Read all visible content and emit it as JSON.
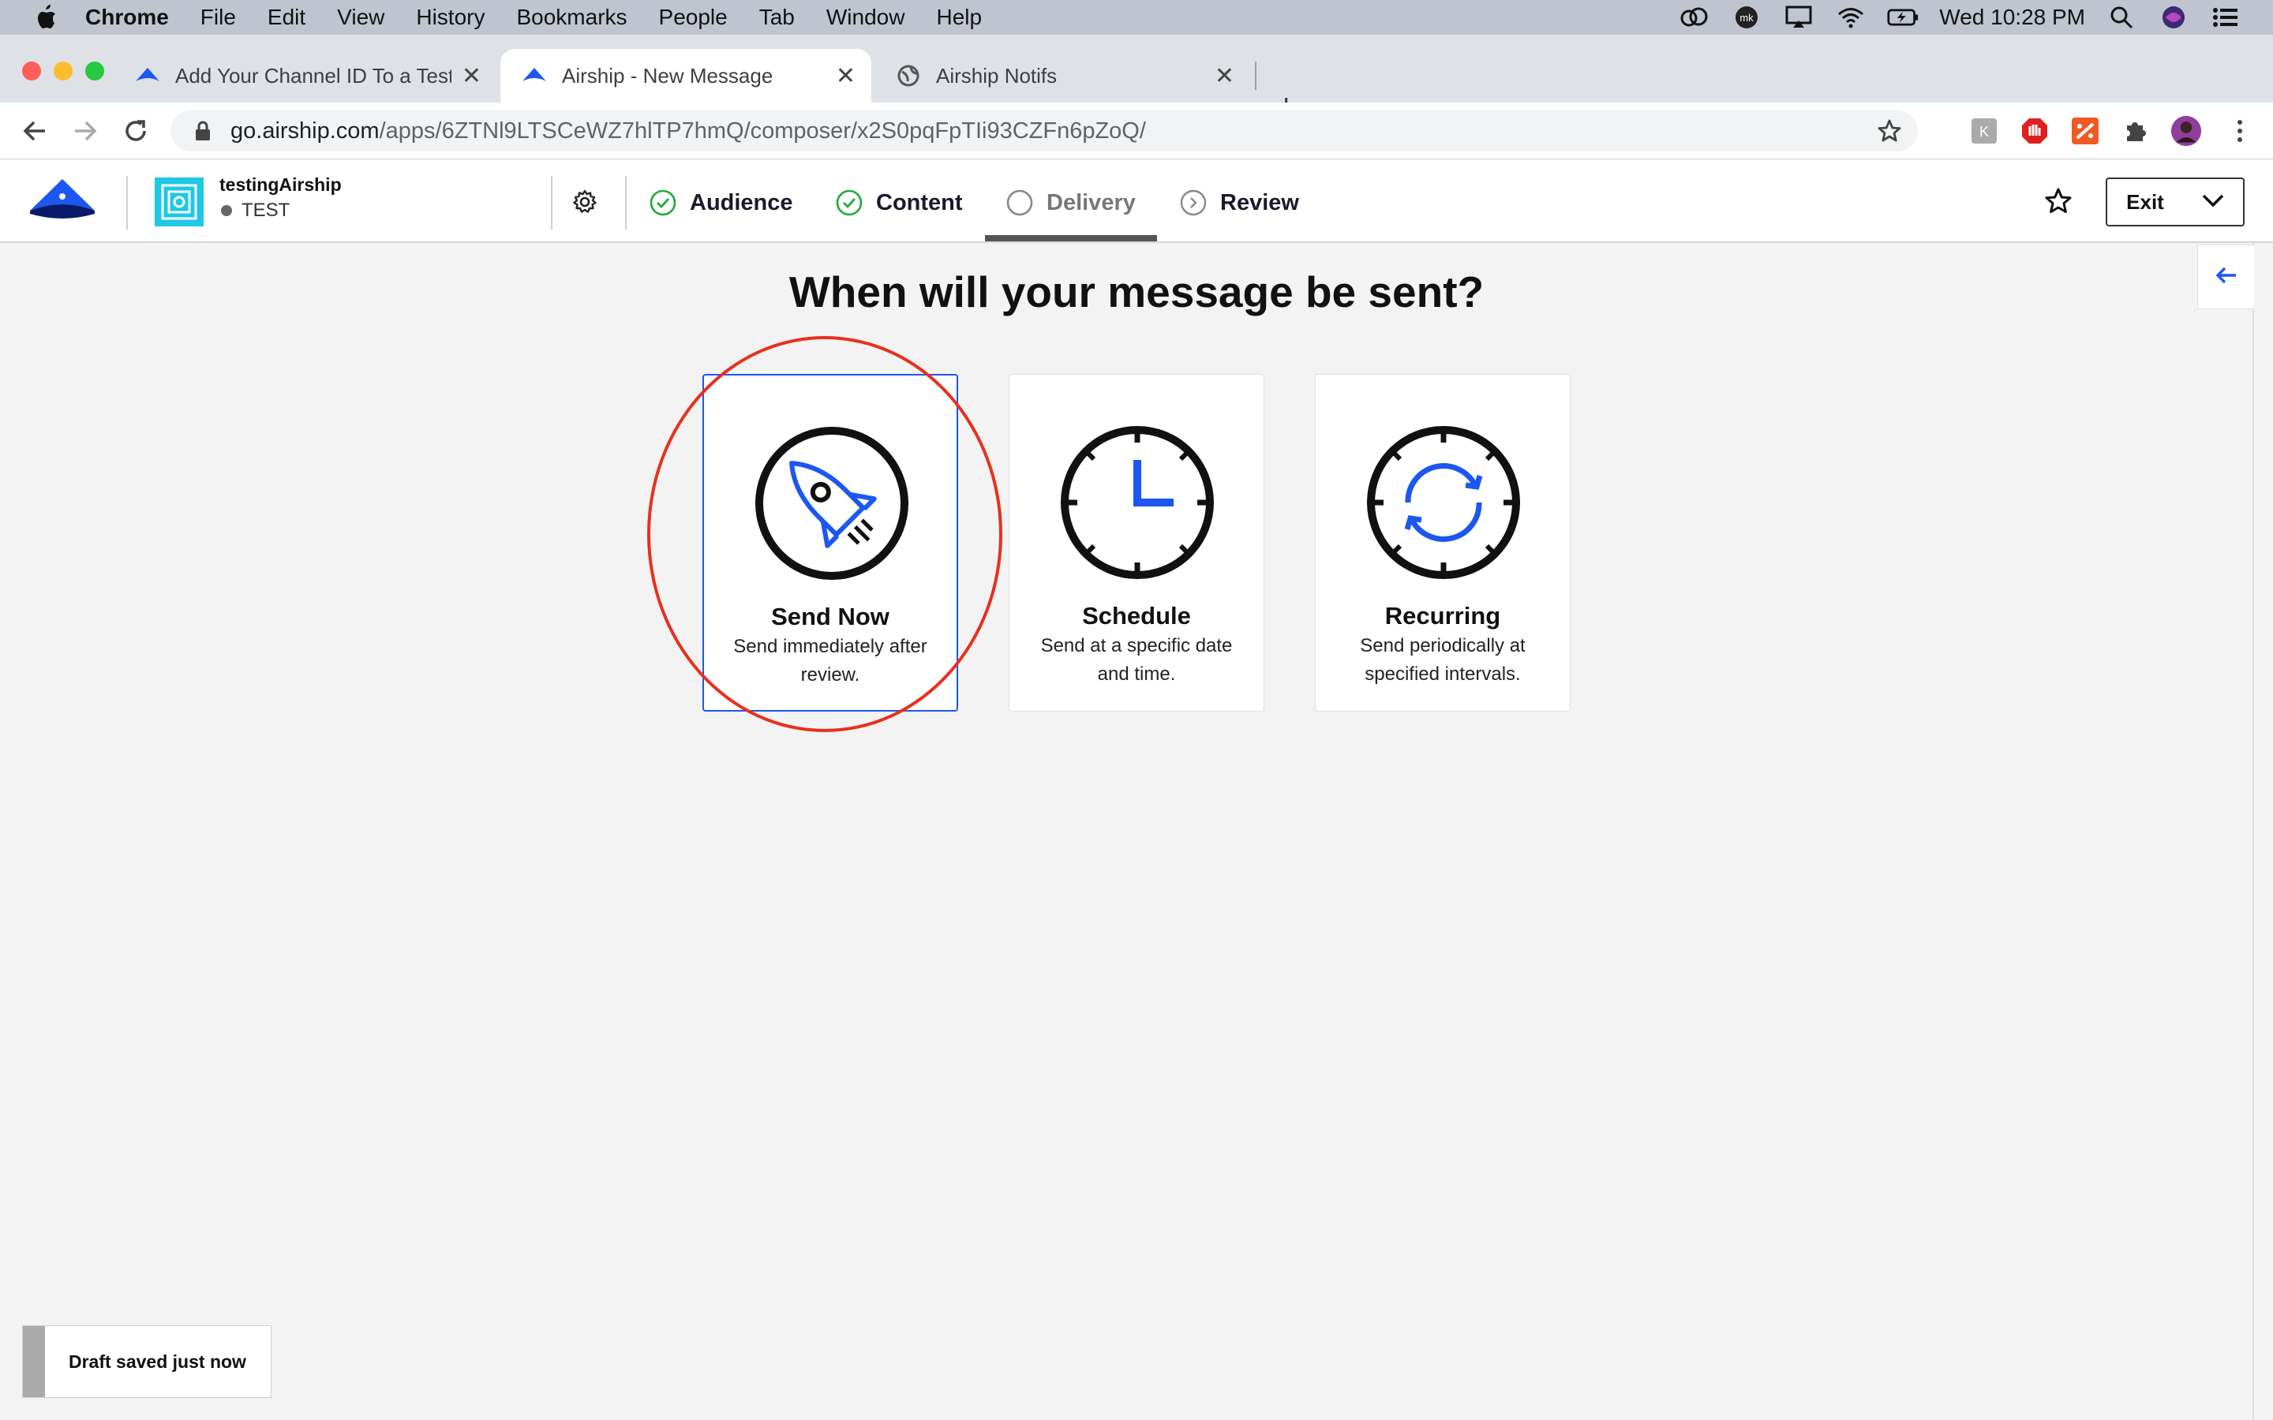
{
  "menubar": {
    "app_name": "Chrome",
    "items": [
      "File",
      "Edit",
      "View",
      "History",
      "Bookmarks",
      "People",
      "Tab",
      "Window",
      "Help"
    ],
    "clock": "Wed 10:28 PM"
  },
  "tabs": [
    {
      "title": "Add Your Channel ID To a Test ·",
      "active": false
    },
    {
      "title": "Airship - New Message",
      "active": true
    },
    {
      "title": "Airship Notifs",
      "active": false
    }
  ],
  "address_bar": {
    "host": "go.airship.com",
    "path": "/apps/6ZTNl9LTSCeWZ7hlTP7hmQ/composer/x2S0pqFpTIi93CZFn6pZoQ/"
  },
  "header": {
    "app_name": "testingAirship",
    "env_label": "TEST",
    "steps": [
      {
        "label": "Audience",
        "state": "complete"
      },
      {
        "label": "Content",
        "state": "complete"
      },
      {
        "label": "Delivery",
        "state": "current"
      },
      {
        "label": "Review",
        "state": "upcoming"
      }
    ],
    "exit_label": "Exit"
  },
  "main": {
    "question": "When will your message be sent?",
    "options": [
      {
        "title": "Send Now",
        "description": "Send immediately after review.",
        "icon": "rocket-icon",
        "selected": true
      },
      {
        "title": "Schedule",
        "description": "Send at a specific date and time.",
        "icon": "clock-icon",
        "selected": false
      },
      {
        "title": "Recurring",
        "description": "Send periodically at specified intervals.",
        "icon": "recurring-icon",
        "selected": false
      }
    ]
  },
  "toast": {
    "text": "Draft saved just now"
  },
  "colors": {
    "accent": "#1b57f0",
    "success": "#1faa3c",
    "annotation": "#e8301c",
    "app_icon": "#1ec8e6"
  }
}
